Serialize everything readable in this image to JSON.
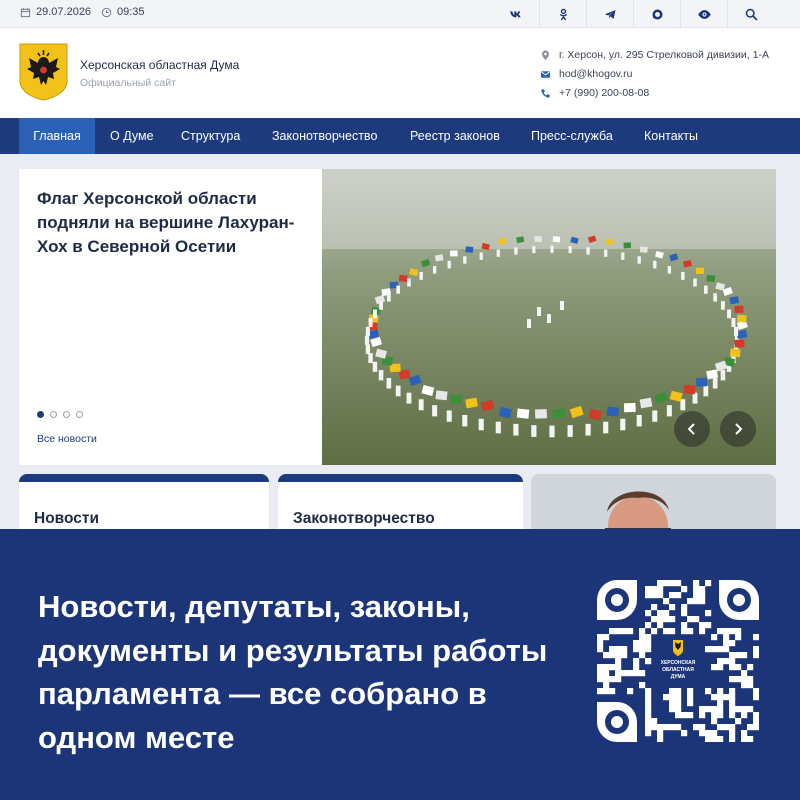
{
  "topbar": {
    "date": "29.07.2026",
    "time": "09:35",
    "socials": [
      "vk-icon",
      "ok-icon",
      "telegram-icon",
      "max-icon",
      "visually-impaired-icon",
      "search-icon"
    ]
  },
  "header": {
    "org_name": "Херсонская областная Дума",
    "org_subtitle": "Официальный сайт",
    "address": "г. Херсон, ул. 295 Стрелковой дивизии, 1-А",
    "email": "hod@khogov.ru",
    "phone": "+7 (990) 200-08-08"
  },
  "nav": {
    "items": [
      "Главная",
      "О Думе",
      "Структура",
      "Законотворчество",
      "Реестр законов",
      "Пресс-служба",
      "Контакты"
    ],
    "active_index": 0
  },
  "hero": {
    "title": "Флаг Херсонской области подняли на вершине Лахуран-Хох в Северной Осетии",
    "slide_count": 4,
    "active_slide": 0,
    "all_news_label": "Все новости"
  },
  "cards": {
    "news_title": "Новости",
    "lawmaking_title": "Законотворчество"
  },
  "banner": {
    "text": "Новости, депутаты, законы, документы и результаты работы парламента — все собрано в одном месте",
    "qr_center_text_1": "ХЕРСОНСКАЯ",
    "qr_center_text_2": "ОБЛАСТНАЯ",
    "qr_center_text_3": "ДУМА"
  },
  "colors": {
    "primary": "#1d3a7c",
    "nav_active": "#2b62b8",
    "banner": "#1c3578",
    "emblem_gold": "#f2c21b"
  }
}
